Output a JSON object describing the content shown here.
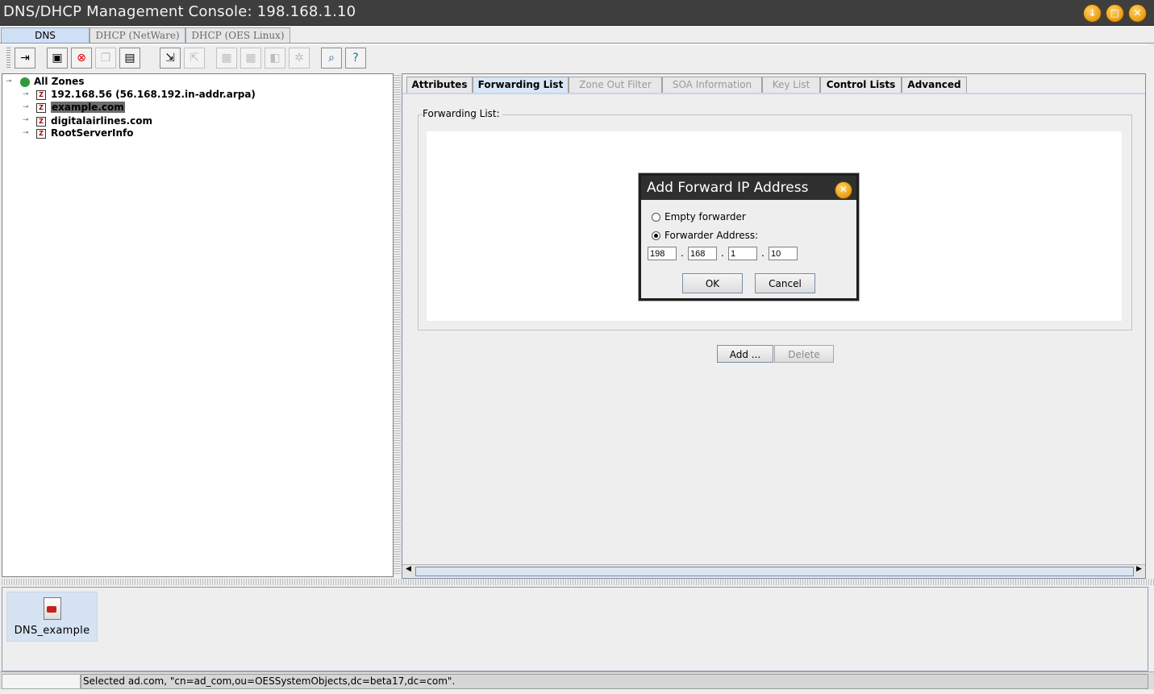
{
  "window": {
    "title": "DNS/DHCP Management Console: 198.168.1.10",
    "controls": [
      "minimize-icon",
      "maximize-icon",
      "close-icon"
    ]
  },
  "top_tabs": [
    {
      "label": "DNS",
      "selected": true
    },
    {
      "label": "DHCP (NetWare)",
      "selected": false
    },
    {
      "label": "DHCP (OES Linux)",
      "selected": false
    }
  ],
  "toolbar": {
    "buttons": [
      {
        "icon": "exit-icon",
        "enabled": true
      },
      {
        "icon": "create-icon",
        "enabled": true
      },
      {
        "icon": "delete-icon",
        "enabled": true
      },
      {
        "icon": "copy-icon",
        "enabled": false
      },
      {
        "icon": "properties-icon",
        "enabled": true
      },
      {
        "icon": "import-icon",
        "enabled": true
      },
      {
        "icon": "export-icon",
        "enabled": false
      },
      {
        "icon": "start-icon",
        "enabled": false
      },
      {
        "icon": "stop-icon",
        "enabled": false
      },
      {
        "icon": "audit-icon",
        "enabled": false
      },
      {
        "icon": "settings-icon",
        "enabled": false
      },
      {
        "icon": "search-icon",
        "enabled": true
      },
      {
        "icon": "help-icon",
        "enabled": true
      }
    ]
  },
  "tree": {
    "root": "All Zones",
    "items": [
      {
        "label": "192.168.56 (56.168.192.in-addr.arpa)",
        "selected": false
      },
      {
        "label": "example.com",
        "selected": true
      },
      {
        "label": "digitalairlines.com",
        "selected": false
      },
      {
        "label": "RootServerInfo",
        "selected": false
      }
    ]
  },
  "detail_tabs": [
    {
      "label": "Attributes",
      "state": "enabled"
    },
    {
      "label": "Forwarding List",
      "state": "selected"
    },
    {
      "label": "Zone Out Filter",
      "state": "disabled"
    },
    {
      "label": "SOA Information",
      "state": "disabled"
    },
    {
      "label": "Key List",
      "state": "disabled"
    },
    {
      "label": "Control Lists",
      "state": "enabled"
    },
    {
      "label": "Advanced",
      "state": "enabled"
    }
  ],
  "forwarding": {
    "section_label": "Forwarding List:",
    "add_label": "Add ...",
    "delete_label": "Delete"
  },
  "dialog": {
    "title": "Add Forward IP Address",
    "option_empty": "Empty forwarder",
    "option_address": "Forwarder Address:",
    "selected_option": "option_address",
    "ip": [
      "198",
      "168",
      "1",
      "10"
    ],
    "ok_label": "OK",
    "cancel_label": "Cancel"
  },
  "bottom": {
    "service_label": "DNS_example"
  },
  "status": {
    "text": "Selected ad.com, \"cn=ad_com,ou=OESSystemObjects,dc=beta17,dc=com\"."
  },
  "colors": {
    "titlebar": "#3e3e3e",
    "window_button": "#e79a10",
    "selected_tab": "#cfe0f5",
    "selection_highlight": "#6d6d6d"
  }
}
